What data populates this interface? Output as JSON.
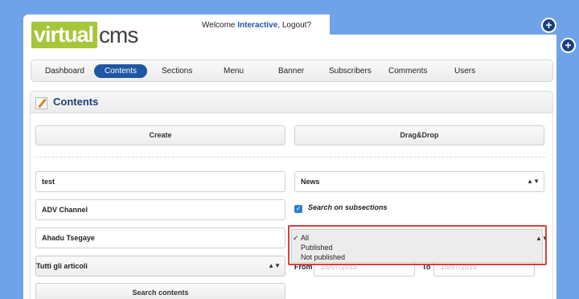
{
  "header": {
    "logo_left": "virtual",
    "logo_right": "cms",
    "welcome_prefix": "Welcome ",
    "welcome_user": "Interactive",
    "welcome_suffix": ", Logout?"
  },
  "nav": {
    "items": [
      {
        "label": "Dashboard"
      },
      {
        "label": "Contents"
      },
      {
        "label": "Sections"
      },
      {
        "label": "Menu"
      },
      {
        "label": "Banner"
      },
      {
        "label": "Subscribers"
      },
      {
        "label": "Comments"
      },
      {
        "label": "Users"
      }
    ],
    "active": "Contents"
  },
  "section": {
    "title": "Contents"
  },
  "actions": {
    "create_label": "Create",
    "dragdrop_label": "Drag&Drop"
  },
  "filters": {
    "title_value": "test",
    "channel_value": "ADV Channel",
    "author_value": "Ahadu Tsegaye",
    "articles_select": "Tutti gli articoli",
    "section_select": "News",
    "search_subsections_label": "Search on subsections",
    "search_subsections_checked": true,
    "from_label": "From",
    "from_value": "15/07/2015",
    "to_label": "To",
    "to_value": "15/07/2015",
    "search_button": "Search contents"
  },
  "status_dropdown": {
    "options": [
      "All",
      "Published",
      "Not published"
    ],
    "selected": "All",
    "check_glyph": "✓"
  },
  "icons": {
    "add_top": "plus-circle-icon",
    "add_right": "plus-circle-icon",
    "section_icon": "pencil-icon"
  },
  "colors": {
    "background": "#6fa3e8",
    "brand_green": "#a6c639",
    "nav_active": "#1e57a3",
    "title_blue": "#1b3f7a",
    "highlight_red": "#e03b3b"
  }
}
